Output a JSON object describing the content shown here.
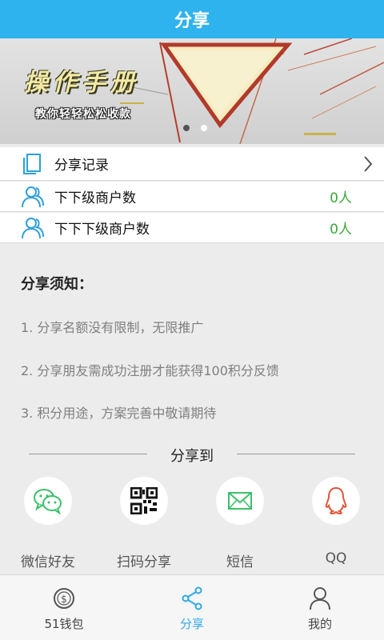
{
  "header": {
    "title": "分享"
  },
  "banner": {
    "title": "操作手册",
    "subtitle": "教你轻轻松松收款",
    "page_count": 2,
    "active_page": 1
  },
  "rows": [
    {
      "label": "分享记录",
      "value": "",
      "icon": "document-icon",
      "has_chevron": true
    },
    {
      "label": "下下级商户数",
      "value": "0人",
      "icon": "users-icon",
      "has_chevron": false
    },
    {
      "label": "下下下级商户数",
      "value": "0人",
      "icon": "users-icon",
      "has_chevron": false
    }
  ],
  "notice": {
    "title": "分享须知：",
    "items": [
      "1. 分享名额没有限制，无限推广",
      "2. 分享朋友需成功注册才能获得100积分反馈",
      "3. 积分用途，方案完善中敬请期待"
    ]
  },
  "share": {
    "heading": "分享到",
    "targets": [
      {
        "label": "微信好友",
        "icon": "wechat-icon"
      },
      {
        "label": "扫码分享",
        "icon": "qrcode-icon"
      },
      {
        "label": "短信",
        "icon": "sms-icon"
      },
      {
        "label": "QQ",
        "icon": "qq-icon"
      }
    ]
  },
  "tabs": [
    {
      "label": "51钱包",
      "icon": "wallet-coin-icon",
      "active": false
    },
    {
      "label": "分享",
      "icon": "share-icon",
      "active": true
    },
    {
      "label": "我的",
      "icon": "user-icon",
      "active": false
    }
  ],
  "colors": {
    "primary": "#2fb3ee",
    "value_green": "#39a839",
    "tab_active": "#2fa9e6"
  }
}
